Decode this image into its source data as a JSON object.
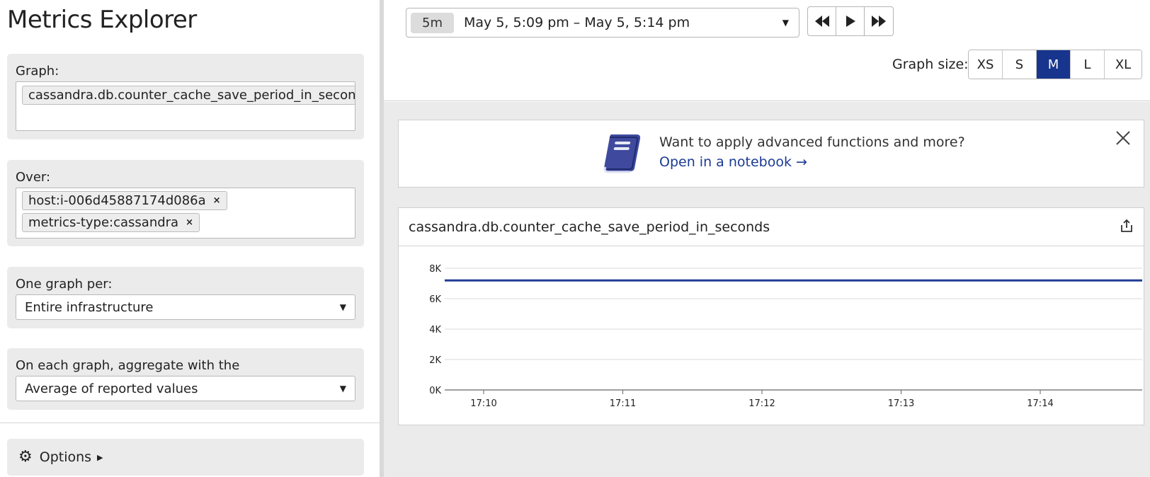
{
  "left": {
    "title": "Metrics Explorer",
    "graph": {
      "label": "Graph:",
      "metric": "cassandra.db.counter_cache_save_period_in_seconds"
    },
    "over": {
      "label": "Over:",
      "tags": [
        "host:i-006d45887174d086a",
        "metrics-type:cassandra"
      ],
      "remove_symbol": "×"
    },
    "one_graph_per": {
      "label": "One graph per:",
      "value": "Entire infrastructure"
    },
    "aggregate": {
      "label": "On each graph, aggregate with the",
      "value": "Average of reported values"
    },
    "options": {
      "label": "Options"
    }
  },
  "toolbar": {
    "time_chip": "5m",
    "time_range": "May 5, 5:09 pm – May 5, 5:14 pm",
    "graph_size_label": "Graph size:",
    "sizes": [
      "XS",
      "S",
      "M",
      "L",
      "XL"
    ],
    "active_size": "M"
  },
  "banner": {
    "text": "Want to apply advanced functions and more?",
    "link": "Open in a notebook →"
  },
  "colors": {
    "accent": "#17358d",
    "series": "#1f3c93",
    "link": "#1a3a94"
  },
  "icons": [
    "chevron-down-icon",
    "rewind-icon",
    "play-icon",
    "fast-forward-icon",
    "notebook-icon",
    "close-icon",
    "export-icon",
    "gear-icon",
    "caret-right-icon"
  ],
  "chart_data": {
    "type": "line",
    "title": "cassandra.db.counter_cache_save_period_in_seconds",
    "x": [
      "17:10",
      "17:11",
      "17:12",
      "17:13",
      "17:14"
    ],
    "x_ticks": [
      "17:10",
      "17:11",
      "17:12",
      "17:13",
      "17:14"
    ],
    "y_ticks": [
      "0K",
      "2K",
      "4K",
      "6K",
      "8K"
    ],
    "series": [
      {
        "values": [
          7200,
          7200,
          7200,
          7200,
          7200
        ]
      }
    ],
    "ylim": [
      0,
      8000
    ],
    "grid": true
  }
}
